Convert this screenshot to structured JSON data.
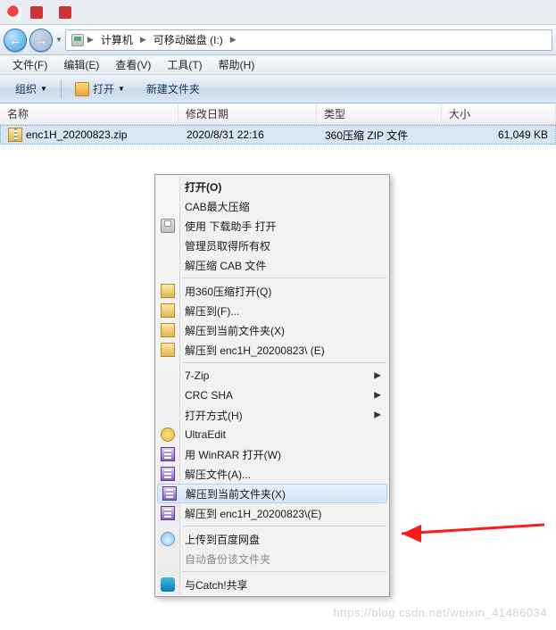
{
  "tabs": [
    {
      "label": ""
    },
    {
      "label": ""
    }
  ],
  "breadcrumb": {
    "segments": [
      "计算机",
      "可移动磁盘 (I:)"
    ]
  },
  "menubar": {
    "file": "文件(F)",
    "edit": "编辑(E)",
    "view": "查看(V)",
    "tools": "工具(T)",
    "help": "帮助(H)"
  },
  "toolbar": {
    "organize": "组织",
    "open": "打开",
    "new_folder": "新建文件夹"
  },
  "columns": {
    "name": "名称",
    "date": "修改日期",
    "type": "类型",
    "size": "大小"
  },
  "file": {
    "name": "enc1H_20200823.zip",
    "date": "2020/8/31 22:16",
    "type": "360压缩 ZIP 文件",
    "size": "61,049 KB"
  },
  "ctx": {
    "open": "打开(O)",
    "cab_max": "CAB最大压缩",
    "dlassist": "使用 下载助手 打开",
    "admin_own": "管理员取得所有权",
    "extract_cab": "解压缩 CAB 文件",
    "open_360": "用360压缩打开(Q)",
    "extract_to": "解压到(F)...",
    "extract_here_360": "解压到当前文件夹(X)",
    "extract_named": "解压到 enc1H_20200823\\ (E)",
    "seven_zip": "7-Zip",
    "crc_sha": "CRC SHA",
    "open_with": "打开方式(H)",
    "ultraedit": "UltraEdit",
    "winrar_open": "用 WinRAR 打开(W)",
    "winrar_files": "解压文件(A)...",
    "winrar_here": "解压到当前文件夹(X)",
    "winrar_named": "解压到 enc1H_20200823\\(E)",
    "baidu_upload": "上传到百度网盘",
    "auto_backup": "自动备份该文件夹",
    "catch_share": "与Catch!共享"
  },
  "watermark": "https://blog.csdn.net/weixin_41486034"
}
